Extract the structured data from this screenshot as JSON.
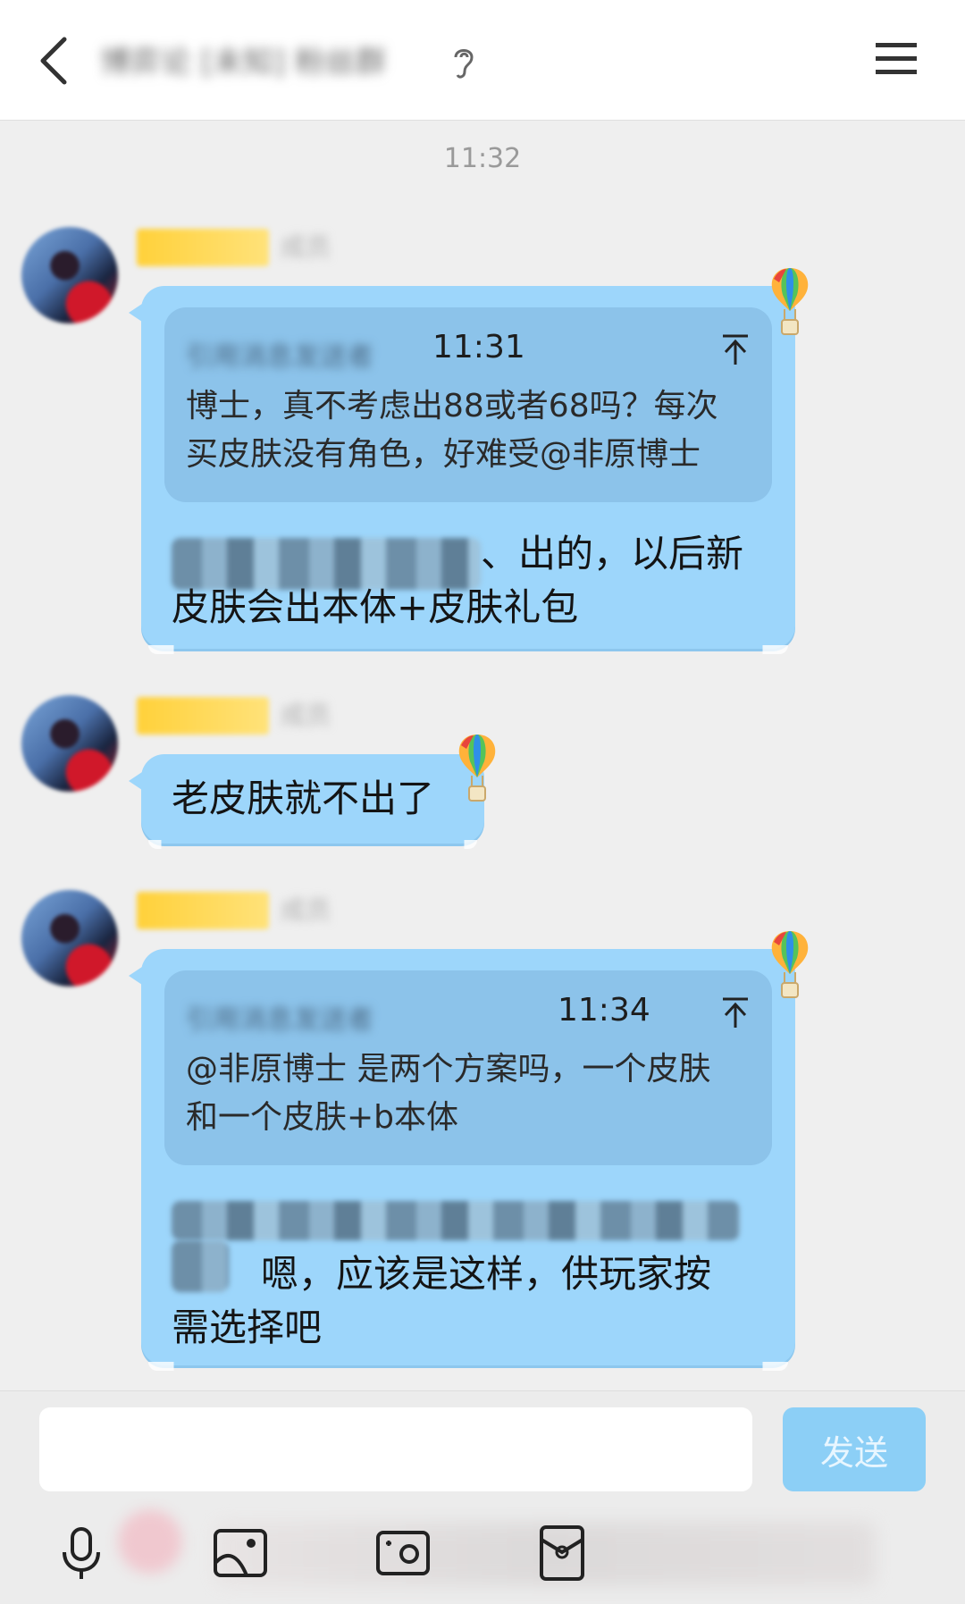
{
  "header": {
    "title": "博弈论 [未知] 粉丝群",
    "icons": [
      "back-icon",
      "ear-icon",
      "menu-icon"
    ]
  },
  "chat": {
    "timestamp": "11:32",
    "messages": [
      {
        "sender_name": "成员",
        "quote": {
          "sender": "引用消息发送者",
          "time": "11:31",
          "text": "博士，真不考虑出88或者68吗？每次买皮肤没有角色，好难受@非原博士"
        },
        "reply_prefix": "、出的，以后新",
        "reply_text": "皮肤会出本体+皮肤礼包"
      },
      {
        "sender_name": "成员",
        "text": "老皮肤就不出了"
      },
      {
        "sender_name": "成员",
        "quote": {
          "sender": "引用消息发送者",
          "time": "11:34",
          "text": "@非原博士 是两个方案吗，一个皮肤和一个皮肤+b本体"
        },
        "reply_prefix": "嗯，应该是这样，供玩家按",
        "reply_text": "需选择吧"
      }
    ]
  },
  "input_bar": {
    "placeholder": "",
    "send_label": "发送",
    "tools": [
      "microphone-icon",
      "image-icon",
      "camera-icon",
      "red-packet-icon"
    ]
  },
  "colors": {
    "bubble": "#9dd6fb",
    "quote_box": "#8cc3ea",
    "send_button": "#8ccff6",
    "background": "#efefef"
  }
}
